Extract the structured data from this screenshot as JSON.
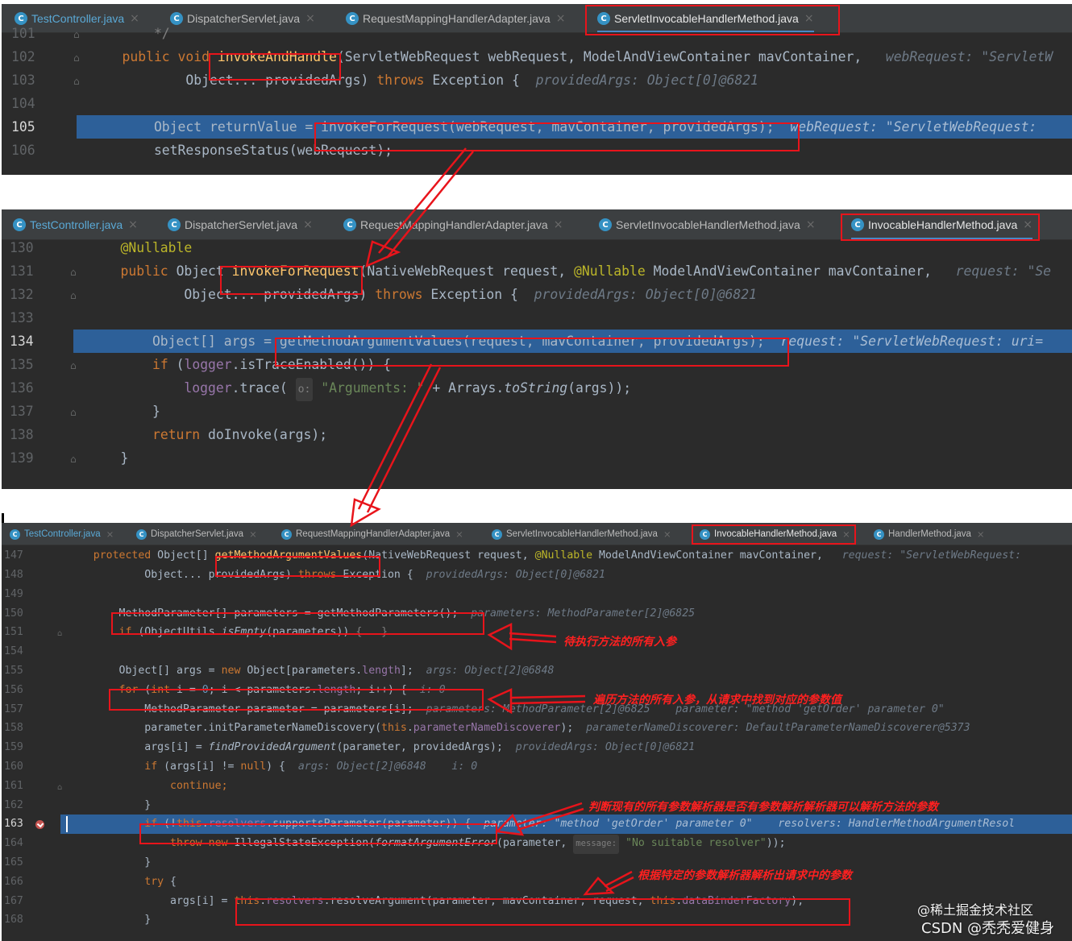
{
  "panel1": {
    "tabs": [
      {
        "label": "TestController.java"
      },
      {
        "label": "DispatcherServlet.java"
      },
      {
        "label": "RequestMappingHandlerAdapter.java"
      },
      {
        "label": "ServletInvocableHandlerMethod.java"
      }
    ],
    "active_tab": 3,
    "lines": [
      {
        "num": "101",
        "segs": [
          {
            "t": "        */",
            "c": "cm"
          }
        ]
      },
      {
        "num": "102",
        "segs": [
          {
            "t": "    public void ",
            "c": "kw"
          },
          {
            "t": "invokeAndHandle",
            "c": "fn"
          },
          {
            "t": "(ServletWebRequest webRequest, ModelAndViewContainer mavContainer,  ",
            "c": "tx"
          },
          {
            "t": " webRequest: \"ServletW",
            "c": "hint"
          }
        ]
      },
      {
        "num": "103",
        "segs": [
          {
            "t": "            Object... providedArgs) ",
            "c": "tx"
          },
          {
            "t": "throws",
            "c": "kw"
          },
          {
            "t": " Exception {  ",
            "c": "tx"
          },
          {
            "t": "providedArgs: Object[0]@6821",
            "c": "hint"
          }
        ]
      },
      {
        "num": "104",
        "segs": []
      },
      {
        "num": "105",
        "hl": true,
        "segs": [
          {
            "t": "        Object returnValue = ",
            "c": "tx"
          },
          {
            "t": "invokeForRequest(webRequest, mavContainer, providedArgs);",
            "c": "tx"
          },
          {
            "t": "  webRequest: \"ServletWebRequest:",
            "c": "hint"
          }
        ]
      },
      {
        "num": "106",
        "segs": [
          {
            "t": "        setResponseStatus(webRequest);",
            "c": "tx"
          }
        ]
      }
    ]
  },
  "panel2": {
    "tabs": [
      {
        "label": "TestController.java"
      },
      {
        "label": "DispatcherServlet.java"
      },
      {
        "label": "RequestMappingHandlerAdapter.java"
      },
      {
        "label": "ServletInvocableHandlerMethod.java"
      },
      {
        "label": "InvocableHandlerMethod.java"
      }
    ],
    "active_tab": 4,
    "lines": [
      {
        "num": "130",
        "segs": [
          {
            "t": "    @Nullable",
            "c": "an"
          }
        ]
      },
      {
        "num": "131",
        "segs": [
          {
            "t": "    public ",
            "c": "kw"
          },
          {
            "t": "Object ",
            "c": "tx"
          },
          {
            "t": "invokeForRequest",
            "c": "fn"
          },
          {
            "t": "(NativeWebRequest request, ",
            "c": "tx"
          },
          {
            "t": "@Nullable",
            "c": "an"
          },
          {
            "t": " ModelAndViewContainer mavContainer,  ",
            "c": "tx"
          },
          {
            "t": " request: \"Se",
            "c": "hint"
          }
        ]
      },
      {
        "num": "132",
        "segs": [
          {
            "t": "            Object... providedArgs) ",
            "c": "tx"
          },
          {
            "t": "throws",
            "c": "kw"
          },
          {
            "t": " Exception {  ",
            "c": "tx"
          },
          {
            "t": "providedArgs: Object[0]@6821",
            "c": "hint"
          }
        ]
      },
      {
        "num": "133",
        "segs": []
      },
      {
        "num": "134",
        "hl": true,
        "segs": [
          {
            "t": "        Object[] args = getMethodArgumentValues(request, mavContainer, providedArgs);",
            "c": "tx"
          },
          {
            "t": "  request: \"ServletWebRequest: uri=",
            "c": "hint"
          }
        ]
      },
      {
        "num": "135",
        "segs": [
          {
            "t": "        ",
            "c": "tx"
          },
          {
            "t": "if",
            "c": "kw"
          },
          {
            "t": " (",
            "c": "tx"
          },
          {
            "t": "logger",
            "c": "fld"
          },
          {
            "t": ".isTraceEnabled()) {",
            "c": "tx"
          }
        ]
      },
      {
        "num": "136",
        "segs": [
          {
            "t": "            ",
            "c": "tx"
          },
          {
            "t": "logger",
            "c": "fld"
          },
          {
            "t": ".trace( ",
            "c": "tx"
          },
          {
            "t": "o:",
            "c": "ph"
          },
          {
            "t": " \"Arguments: \"",
            "c": "st"
          },
          {
            "t": " + Arrays.",
            "c": "tx"
          },
          {
            "t": "toString",
            "c": "tx it"
          },
          {
            "t": "(args));",
            "c": "tx"
          }
        ]
      },
      {
        "num": "137",
        "segs": [
          {
            "t": "        }",
            "c": "tx"
          }
        ]
      },
      {
        "num": "138",
        "segs": [
          {
            "t": "        ",
            "c": "tx"
          },
          {
            "t": "return",
            "c": "kw"
          },
          {
            "t": " doInvoke(args);",
            "c": "tx"
          }
        ]
      },
      {
        "num": "139",
        "segs": [
          {
            "t": "    }",
            "c": "tx"
          }
        ]
      }
    ]
  },
  "panel3": {
    "tabs": [
      {
        "label": "TestController.java"
      },
      {
        "label": "DispatcherServlet.java"
      },
      {
        "label": "RequestMappingHandlerAdapter.java"
      },
      {
        "label": "ServletInvocableHandlerMethod.java"
      },
      {
        "label": "InvocableHandlerMethod.java"
      },
      {
        "label": "HandlerMethod.java"
      }
    ],
    "active_tab": 4,
    "lines": [
      {
        "num": "147",
        "segs": [
          {
            "t": "    protected ",
            "c": "kw"
          },
          {
            "t": "Object[] ",
            "c": "tx"
          },
          {
            "t": "getMethodArgumentValues",
            "c": "fn"
          },
          {
            "t": "(NativeWebRequest request, ",
            "c": "tx"
          },
          {
            "t": "@Nullable",
            "c": "an"
          },
          {
            "t": " ModelAndViewContainer mavContainer,  ",
            "c": "tx"
          },
          {
            "t": " request: \"ServletWebRequest:",
            "c": "hint"
          }
        ]
      },
      {
        "num": "148",
        "segs": [
          {
            "t": "            Object... providedArgs) ",
            "c": "tx"
          },
          {
            "t": "throws",
            "c": "kw"
          },
          {
            "t": " Exception {  ",
            "c": "tx"
          },
          {
            "t": "providedArgs: Object[0]@6821",
            "c": "hint"
          }
        ]
      },
      {
        "num": "149",
        "segs": []
      },
      {
        "num": "150",
        "segs": [
          {
            "t": "        MethodParameter[] parameters = getMethodParameters();  ",
            "c": "tx"
          },
          {
            "t": "parameters: MethodParameter[2]@6825",
            "c": "hint"
          }
        ]
      },
      {
        "num": "151",
        "segs": [
          {
            "t": "        ",
            "c": "tx"
          },
          {
            "t": "if",
            "c": "kw"
          },
          {
            "t": " (ObjectUtils.",
            "c": "tx"
          },
          {
            "t": "isEmpty",
            "c": "tx it"
          },
          {
            "t": "(parameters)) ",
            "c": "tx"
          },
          {
            "t": "{...}",
            "c": "cm"
          }
        ]
      },
      {
        "num": "154",
        "segs": []
      },
      {
        "num": "155",
        "segs": [
          {
            "t": "        Object[] args = ",
            "c": "tx"
          },
          {
            "t": "new",
            "c": "kw"
          },
          {
            "t": " Object[parameters.",
            "c": "tx"
          },
          {
            "t": "length",
            "c": "fld"
          },
          {
            "t": "];  ",
            "c": "tx"
          },
          {
            "t": "args: Object[2]@6848",
            "c": "hint"
          }
        ]
      },
      {
        "num": "156",
        "segs": [
          {
            "t": "        ",
            "c": "tx"
          },
          {
            "t": "for",
            "c": "kw"
          },
          {
            "t": " (",
            "c": "tx"
          },
          {
            "t": "int",
            "c": "kw"
          },
          {
            "t": " i = ",
            "c": "tx"
          },
          {
            "t": "0",
            "c": "nm"
          },
          {
            "t": "; i < parameters.",
            "c": "tx"
          },
          {
            "t": "length",
            "c": "fld"
          },
          {
            "t": "; i++) {  ",
            "c": "tx"
          },
          {
            "t": "i: 0",
            "c": "hint"
          }
        ]
      },
      {
        "num": "157",
        "segs": [
          {
            "t": "            MethodParameter parameter = parameters[i];  ",
            "c": "tx"
          },
          {
            "t": "parameters: MethodParameter[2]@6825    parameter: \"method 'getOrder' parameter 0\"",
            "c": "hint"
          }
        ]
      },
      {
        "num": "158",
        "segs": [
          {
            "t": "            parameter.initParameterNameDiscovery(",
            "c": "tx"
          },
          {
            "t": "this",
            "c": "kw"
          },
          {
            "t": ".",
            "c": "tx"
          },
          {
            "t": "parameterNameDiscoverer",
            "c": "fld"
          },
          {
            "t": ");  ",
            "c": "tx"
          },
          {
            "t": "parameterNameDiscoverer: DefaultParameterNameDiscoverer@5373",
            "c": "hint"
          }
        ]
      },
      {
        "num": "159",
        "segs": [
          {
            "t": "            args[i] = ",
            "c": "tx"
          },
          {
            "t": "findProvidedArgument",
            "c": "tx it"
          },
          {
            "t": "(parameter, providedArgs);  ",
            "c": "tx"
          },
          {
            "t": "providedArgs: Object[0]@6821",
            "c": "hint"
          }
        ]
      },
      {
        "num": "160",
        "segs": [
          {
            "t": "            ",
            "c": "tx"
          },
          {
            "t": "if",
            "c": "kw"
          },
          {
            "t": " (args[i] != ",
            "c": "tx"
          },
          {
            "t": "null",
            "c": "kw"
          },
          {
            "t": ") {  ",
            "c": "tx"
          },
          {
            "t": "args: Object[2]@6848    i: 0",
            "c": "hint"
          }
        ]
      },
      {
        "num": "161",
        "segs": [
          {
            "t": "                ",
            "c": "tx"
          },
          {
            "t": "continue",
            "c": "kw"
          },
          {
            "t": ";",
            "c": "kw"
          }
        ]
      },
      {
        "num": "162",
        "segs": [
          {
            "t": "            }",
            "c": "tx"
          }
        ]
      },
      {
        "num": "163",
        "hl": true,
        "segs": [
          {
            "t": "            ",
            "c": "tx"
          },
          {
            "t": "if",
            "c": "kw"
          },
          {
            "t": " (!",
            "c": "tx"
          },
          {
            "t": "this",
            "c": "kw"
          },
          {
            "t": ".",
            "c": "tx"
          },
          {
            "t": "resolvers",
            "c": "fld"
          },
          {
            "t": ".supportsParameter(parameter)) {  ",
            "c": "tx"
          },
          {
            "t": "parameter: \"method 'getOrder' parameter 0\"    resolvers: HandlerMethodArgumentResol",
            "c": "hint"
          }
        ]
      },
      {
        "num": "164",
        "segs": [
          {
            "t": "                ",
            "c": "tx"
          },
          {
            "t": "throw new",
            "c": "kw"
          },
          {
            "t": " IllegalStateException(",
            "c": "tx"
          },
          {
            "t": "formatArgumentError",
            "c": "tx it"
          },
          {
            "t": "(parameter, ",
            "c": "tx"
          },
          {
            "t": "message:",
            "c": "ph"
          },
          {
            "t": " \"No suitable resolver\"",
            "c": "st"
          },
          {
            "t": "));",
            "c": "tx"
          }
        ]
      },
      {
        "num": "165",
        "segs": [
          {
            "t": "            }",
            "c": "tx"
          }
        ]
      },
      {
        "num": "166",
        "segs": [
          {
            "t": "            ",
            "c": "tx"
          },
          {
            "t": "try",
            "c": "kw"
          },
          {
            "t": " {",
            "c": "tx"
          }
        ]
      },
      {
        "num": "167",
        "segs": [
          {
            "t": "                args[i] = ",
            "c": "tx"
          },
          {
            "t": "this",
            "c": "kw"
          },
          {
            "t": ".",
            "c": "tx"
          },
          {
            "t": "resolvers",
            "c": "fld"
          },
          {
            "t": ".resolveArgument(parameter, mavContainer, request, ",
            "c": "tx"
          },
          {
            "t": "this",
            "c": "kw"
          },
          {
            "t": ".",
            "c": "tx"
          },
          {
            "t": "dataBinderFactory",
            "c": "fld"
          },
          {
            "t": ");",
            "c": "tx"
          }
        ]
      },
      {
        "num": "168",
        "segs": [
          {
            "t": "            }",
            "c": "tx"
          }
        ]
      }
    ]
  },
  "annotations": {
    "a1": "待执行方法的所有入参",
    "a2": "遍历方法的所有入参，从请求中找到对应的参数值",
    "a3": "判断现有的所有参数解析器是否有参数解析解析器可以解析方法的参数",
    "a4": "根据特定的参数解析器解析出请求中的参数"
  },
  "watermark": {
    "line1": "@稀土掘金技术社区",
    "line2": "CSDN @秃秃爱健身"
  },
  "colors": {
    "red": "#e8141b",
    "editor_bg": "#2b2b2b",
    "highlight": "#2d6099"
  }
}
